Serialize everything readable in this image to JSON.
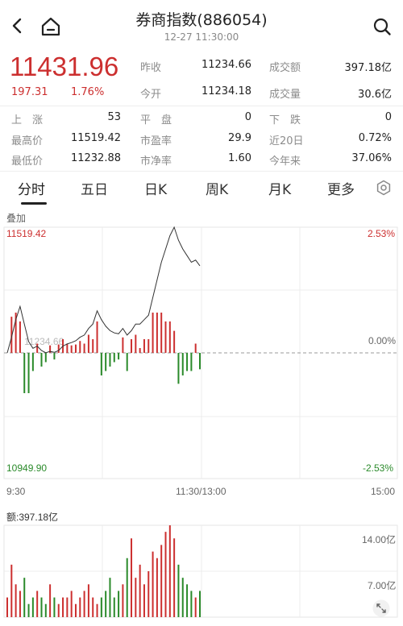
{
  "header": {
    "title": "券商指数(886054)",
    "time": "12-27 11:30:00"
  },
  "quote": {
    "price": "11431.96",
    "change": "197.31",
    "change_pct": "1.76%",
    "fields": [
      {
        "label": "昨收",
        "value": "11234.66"
      },
      {
        "label": "成交额",
        "value": "397.18亿"
      },
      {
        "label": "今开",
        "value": "11234.18"
      },
      {
        "label": "成交量",
        "value": "30.6亿"
      },
      {
        "label": "上　涨",
        "value": "53"
      },
      {
        "label": "平　盘",
        "value": "0"
      },
      {
        "label": "下　跌",
        "value": "0"
      },
      {
        "label": "最高价",
        "value": "11519.42"
      },
      {
        "label": "市盈率",
        "value": "29.9"
      },
      {
        "label": "近20日",
        "value": "0.72%"
      },
      {
        "label": "最低价",
        "value": "11232.88"
      },
      {
        "label": "市净率",
        "value": "1.60"
      },
      {
        "label": "今年来",
        "value": "37.06%"
      }
    ]
  },
  "tabs": [
    "分时",
    "五日",
    "日K",
    "周K",
    "月K",
    "更多"
  ],
  "chart": {
    "overlay_label": "叠加",
    "high_label": "11519.42",
    "low_label": "10949.90",
    "mid_label": "11234.66",
    "pct_high": "2.53%",
    "pct_mid": "0.00%",
    "pct_low": "-2.53%",
    "time_start": "9:30",
    "time_mid": "11:30/13:00",
    "time_end": "15:00",
    "volume_label": "额:397.18亿",
    "volume_top": "14.00亿",
    "volume_mid": "7.00亿"
  },
  "colors": {
    "up": "#cc2f2f",
    "down": "#2a8a2a",
    "price_line": "#333333"
  },
  "chart_data": {
    "type": "line",
    "x_range": [
      "9:30",
      "15:00"
    ],
    "y_range": [
      10949.9,
      11519.42
    ],
    "price": [
      11234.66,
      11270,
      11310,
      11340,
      11300,
      11260,
      11245,
      11250,
      11240,
      11235,
      11238,
      11236,
      11240,
      11250,
      11255,
      11258,
      11262,
      11270,
      11275,
      11290,
      11300,
      11330,
      11310,
      11295,
      11285,
      11280,
      11278,
      11290,
      11275,
      11285,
      11300,
      11300,
      11310,
      11320,
      11360,
      11400,
      11440,
      11470,
      11500,
      11519.42,
      11490,
      11470,
      11455,
      11440,
      11445,
      11431.96
    ],
    "volume_max": 14.0,
    "volume": [
      3,
      8,
      5,
      4,
      6,
      2,
      3,
      4,
      3,
      2,
      5,
      3,
      2,
      3,
      3,
      4,
      2,
      3,
      4,
      5,
      3,
      2,
      3,
      4,
      6,
      3,
      4,
      5,
      9,
      12,
      6,
      8,
      5,
      7,
      10,
      9,
      11,
      13,
      14,
      12,
      8,
      6,
      5,
      4,
      3,
      4
    ]
  }
}
